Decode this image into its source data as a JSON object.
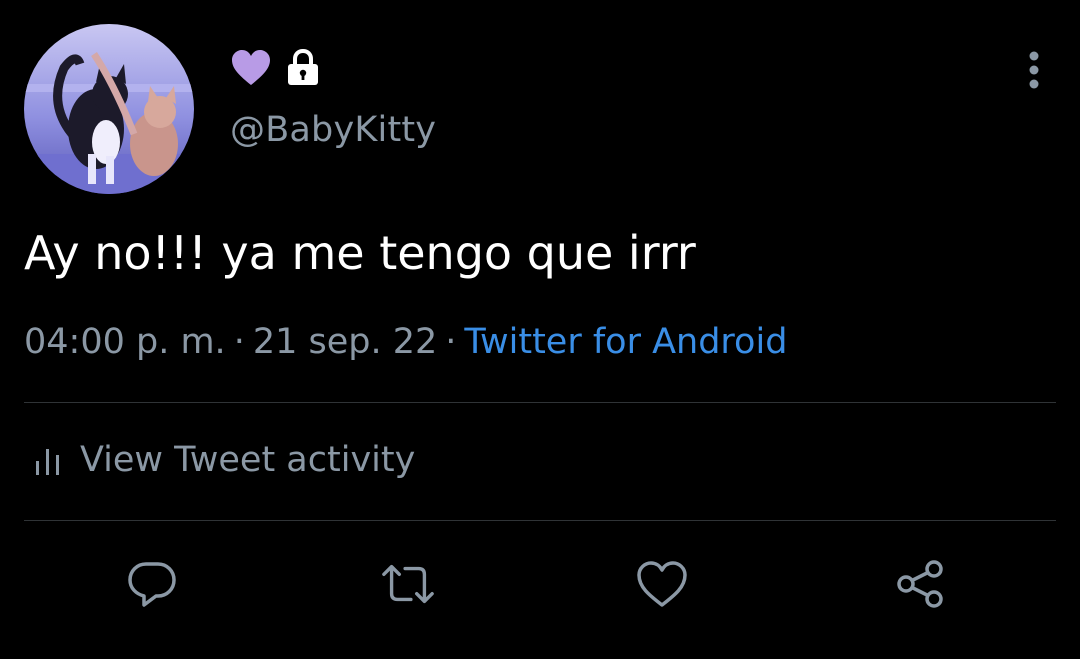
{
  "author": {
    "handle": "@BabyKitty",
    "avatar": "profile-photo-cats",
    "badge_icon": "purple-heart-icon",
    "badge_color": "#b89be6",
    "protected_icon": "lock-icon"
  },
  "tweet": {
    "text": "Ay no!!! ya me tengo que irrr",
    "time": "04:00 p. m.",
    "date": "21 sep. 22",
    "separator": "·",
    "source": "Twitter for Android"
  },
  "activity": {
    "icon": "bar-chart-icon",
    "label": "View Tweet activity"
  },
  "actions": [
    {
      "name": "reply",
      "icon": "reply-icon"
    },
    {
      "name": "retweet",
      "icon": "retweet-icon"
    },
    {
      "name": "like",
      "icon": "heart-outline-icon"
    },
    {
      "name": "share",
      "icon": "share-icon"
    }
  ],
  "colors": {
    "background": "#000000",
    "text_primary": "#ffffff",
    "text_secondary": "#8b98a5",
    "link": "#3a8ee6",
    "divider": "#2f3336"
  }
}
